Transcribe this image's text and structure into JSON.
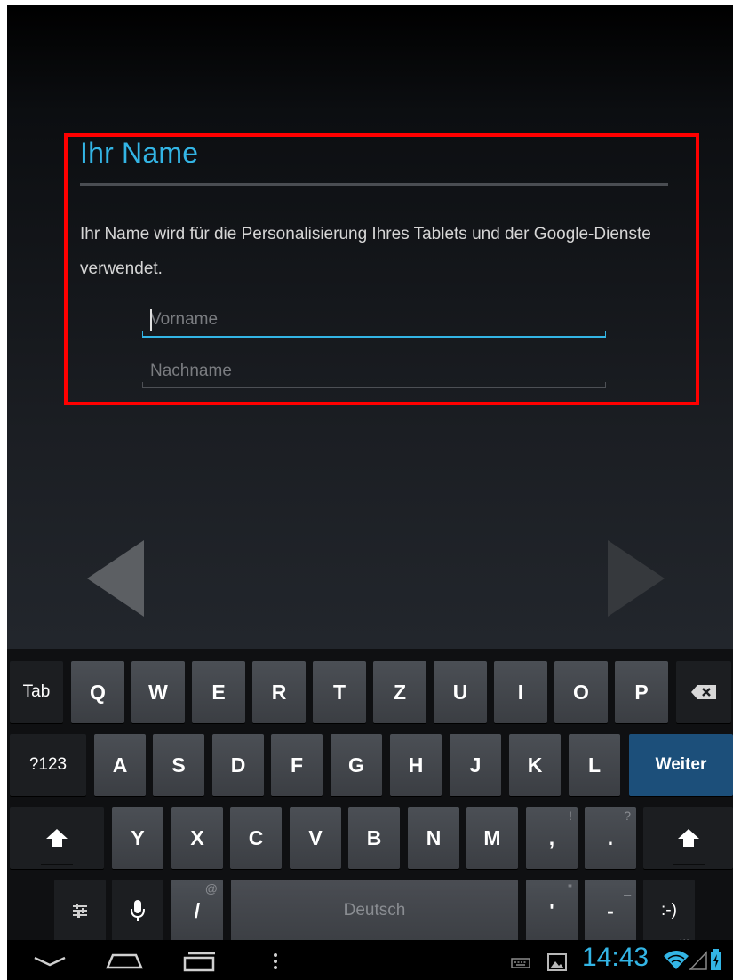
{
  "form": {
    "title": "Ihr Name",
    "description": "Ihr Name wird für die Personalisierung Ihres Tablets und der Google-Dienste verwendet.",
    "first_name_placeholder": "Vorname",
    "first_name_value": "",
    "last_name_placeholder": "Nachname",
    "last_name_value": ""
  },
  "keyboard": {
    "row1": [
      "Tab",
      "Q",
      "W",
      "E",
      "R",
      "T",
      "Z",
      "U",
      "I",
      "O",
      "P"
    ],
    "row2": [
      "?123",
      "A",
      "S",
      "D",
      "F",
      "G",
      "H",
      "J",
      "K",
      "L",
      "Weiter"
    ],
    "row3": [
      "Y",
      "X",
      "C",
      "V",
      "B",
      "N",
      "M",
      ",",
      "."
    ],
    "row3_alts": [
      "!",
      "?"
    ],
    "row4_alts": [
      "@",
      "\"",
      "_",
      "..."
    ],
    "slash": "/",
    "apostrophe": "'",
    "dash": "-",
    "smiley": ":-)",
    "space_label": "Deutsch"
  },
  "statusbar": {
    "time": "14:43"
  },
  "colors": {
    "accent": "#33b5e5",
    "highlight": "#ff0000",
    "enter_key": "#1c4f7a"
  }
}
